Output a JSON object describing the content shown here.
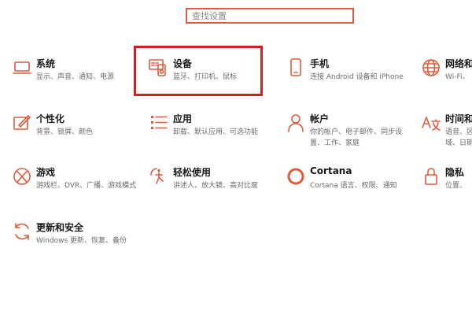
{
  "search": {
    "placeholder": "查找设置"
  },
  "tiles": [
    {
      "title": "系统",
      "desc": "显示、声音、通知、电源"
    },
    {
      "title": "设备",
      "desc": "蓝牙、打印机、鼠标"
    },
    {
      "title": "手机",
      "desc": "连接 Android 设备和 iPhone"
    },
    {
      "title": "网络和",
      "desc": "Wi-Fi、"
    },
    {
      "title": "个性化",
      "desc": "背景、锁屏、颜色"
    },
    {
      "title": "应用",
      "desc": "卸载、默认应用、可选功能"
    },
    {
      "title": "帐户",
      "desc": "你的帐户、电子邮件、同步设置、工作、家庭"
    },
    {
      "title": "时间和",
      "desc": "语音、区域、日期"
    },
    {
      "title": "游戏",
      "desc": "游戏栏、DVR、广播、游戏模式"
    },
    {
      "title": "轻松使用",
      "desc": "讲述人、放大镜、高对比度"
    },
    {
      "title": "Cortana",
      "desc": "Cortana 语言、权限、通知"
    },
    {
      "title": "隐私",
      "desc": "位置、"
    },
    {
      "title": "更新和安全",
      "desc": "Windows 更新、恢复、备份"
    }
  ],
  "accent_color": "#e05a3c",
  "highlight_color": "#d21f1f"
}
